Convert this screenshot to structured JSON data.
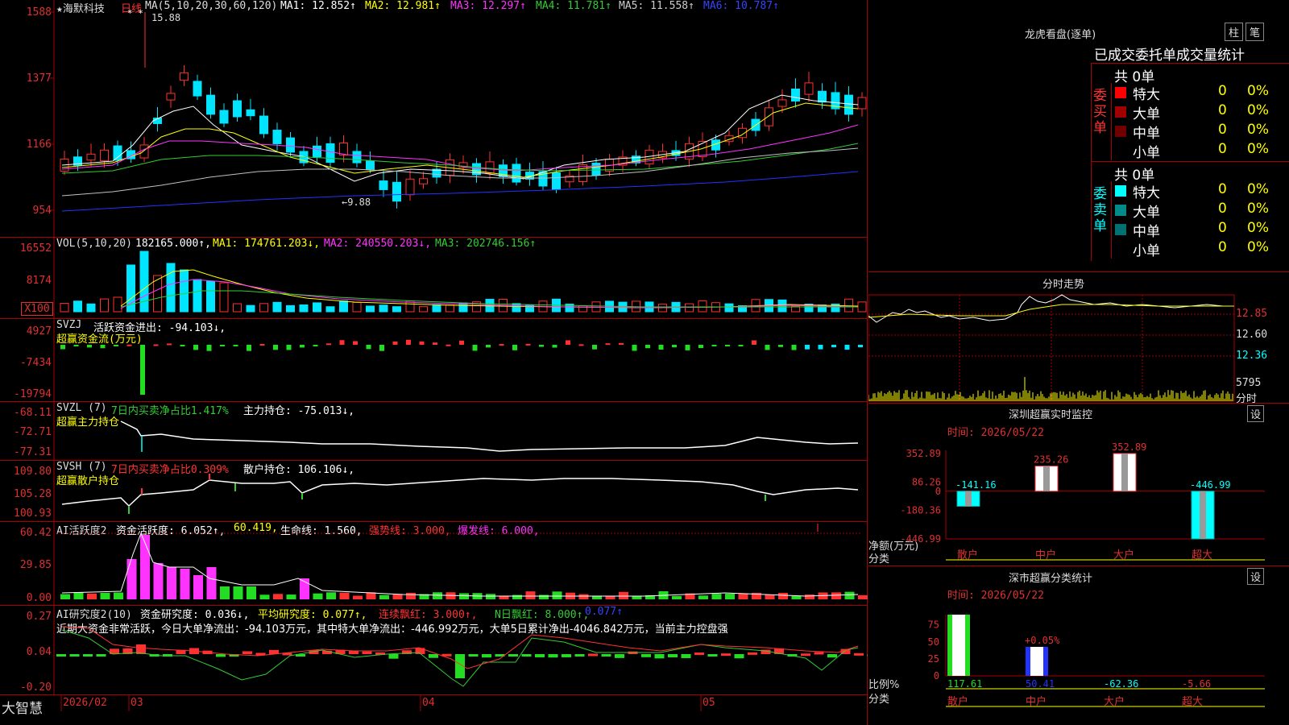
{
  "colors": {
    "up": "#ff3030",
    "down": "#00e5ff",
    "grid": "#a00000",
    "ma1": "#ffffff",
    "ma2": "#ffff00",
    "ma3": "#ff33ff",
    "ma4": "#33cc33",
    "ma5": "#c0c0c0",
    "ma6": "#2233ff"
  },
  "top": {
    "star_title": "★海默科技",
    "period": "日线",
    "ma_title": "MA(5,10,20,30,60,120)",
    "ma1": "MA1: 12.852↑",
    "ma2": "MA2: 12.981↑",
    "ma3": "MA3: 12.297↑",
    "ma4": "MA4: 11.781↑",
    "ma5": "MA5: 11.558↑",
    "ma6": "MA6: 10.787↑",
    "y_ticks": [
      "1588",
      "1377",
      "1166",
      "954"
    ],
    "high_mark": "15.88",
    "low_mark": "←9.88",
    "star_marks": "* *"
  },
  "vol": {
    "title": "VOL(5,10,20)",
    "value": "182165.000↑,",
    "ma1": "MA1: 174761.203↓,",
    "ma2": "MA2: 240550.203↓,",
    "ma3": "MA3: 202746.156↑",
    "y_ticks": [
      "16552",
      "8174"
    ],
    "unit": "X100"
  },
  "svzj": {
    "title": "SVZJ",
    "line1": "活跃资金进出: -94.103↓,",
    "line2": "超赢资金流(万元)",
    "y_ticks": [
      "4927",
      "-7434",
      "-19794"
    ]
  },
  "svzl": {
    "title": "SVZL (7)",
    "a": "7日内买卖净占比1.417%",
    "b": "主力持仓: -75.013↓,",
    "line2": "超赢主力持仓",
    "y_ticks": [
      "-68.11",
      "-72.71",
      "-77.31"
    ]
  },
  "svsh": {
    "title": "SVSH (7)",
    "a": "7日内买卖净占比0.309%",
    "b": "散户持仓: 106.106↓,",
    "line2": "超赢散户持仓",
    "y_ticks": [
      "109.80",
      "105.28",
      "100.93"
    ]
  },
  "ai": {
    "title": "AI活跃度2",
    "a": "资金活跃度: 6.052↑,",
    "b": "60.419,",
    "c": "生命线: 1.560,",
    "d": "强势线: 3.000,",
    "e": "爆发线: 6.000,",
    "y_ticks": [
      "60.42",
      "29.85",
      "0.00"
    ]
  },
  "ai2": {
    "title": "AI研究度2(10)",
    "a": "资金研究度: 0.036↓,",
    "b": "平均研究度: 0.077↑,",
    "c": "连续飘红: 3.000↑,",
    "d": "N日飘红: 8.000↑,",
    "e": "0.077↑",
    "desc": "近期大资金非常活跃，今日大单净流出：-94.103万元，其中特大单净流出：-446.992万元，大单5日累计净出-4046.842万元，当前主力控盘强",
    "y_ticks": [
      "0.27",
      "0.04",
      "-0.20"
    ]
  },
  "bottom": {
    "brand": "大智慧",
    "dates": [
      "2026/02",
      "03",
      "04",
      "05"
    ]
  },
  "lhb": {
    "title": "龙虎看盘(逐单)",
    "btn1": "柱",
    "btn2": "笔",
    "subtitle": "已成交委托单成交量统计",
    "buy_label": "委买单",
    "sell_label": "委卖单",
    "buy_total": "共 0单",
    "sell_total": "共 0单",
    "buy_rows": [
      {
        "name": "特大",
        "count": "0",
        "pct": "0%",
        "color": "#ff0000"
      },
      {
        "name": "大单",
        "count": "0",
        "pct": "0%",
        "color": "#a00000"
      },
      {
        "name": "中单",
        "count": "0",
        "pct": "0%",
        "color": "#700000"
      },
      {
        "name": "小单",
        "count": "0",
        "pct": "0%",
        "color": "#000000"
      }
    ],
    "sell_rows": [
      {
        "name": "特大",
        "count": "0",
        "pct": "0%",
        "color": "#00ffff"
      },
      {
        "name": "大单",
        "count": "0",
        "pct": "0%",
        "color": "#008b8b"
      },
      {
        "name": "中单",
        "count": "0",
        "pct": "0%",
        "color": "#007070"
      },
      {
        "name": "小单",
        "count": "0",
        "pct": "0%",
        "color": "#000000"
      }
    ]
  },
  "fs": {
    "title": "分时走势",
    "y_ticks": [
      "12.85",
      "12.60",
      "12.36"
    ],
    "vol_label": "5795",
    "fenji": "分时"
  },
  "sz_monitor": {
    "title": "深圳超赢实时监控",
    "gear": "设",
    "time": "时间: 2026/05/22",
    "y_ticks": [
      "352.89",
      "86.26",
      "0",
      "-180.36",
      "-446.99"
    ],
    "ylabel1": "净额(万元)",
    "ylabel2": "分类",
    "categories": [
      "散户",
      "中户",
      "大户",
      "超大"
    ],
    "values": [
      -141.16,
      235.26,
      352.89,
      -446.99
    ],
    "value_labels": [
      "-141.16",
      "235.26",
      "352.89",
      "-446.99"
    ]
  },
  "sz_stats": {
    "title": "深市超赢分类统计",
    "gear": "设",
    "time": "时间: 2026/05/22",
    "y_ticks": [
      "75",
      "50",
      "25",
      "0"
    ],
    "ylabel1": "比例%",
    "ylabel2": "分类",
    "categories": [
      "散户",
      "中户",
      "大户",
      "超大"
    ],
    "bottom_values": [
      "117.61",
      "50.41",
      "-62.36",
      "-5.66"
    ],
    "top_label": "+0.05%"
  }
}
